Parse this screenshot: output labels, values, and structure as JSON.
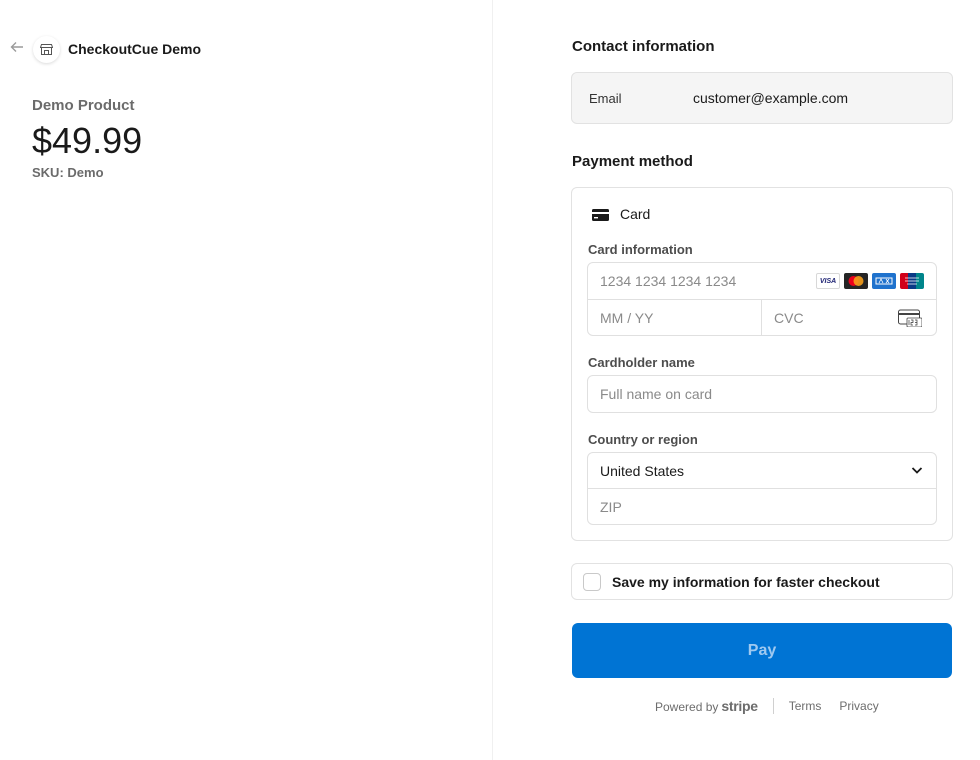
{
  "merchant": {
    "name": "CheckoutCue Demo",
    "logo_icon": "storefront-icon",
    "back_icon": "arrow-left-icon"
  },
  "product": {
    "name": "Demo Product",
    "price": "$49.99",
    "sku": "SKU: Demo"
  },
  "contact": {
    "title": "Contact information",
    "email_label": "Email",
    "email_value": "customer@example.com"
  },
  "payment": {
    "title": "Payment method",
    "method_label": "Card",
    "method_icon": "credit-card-icon",
    "card_info_label": "Card information",
    "card_number_placeholder": "1234 1234 1234 1234",
    "expiry_placeholder": "MM / YY",
    "cvc_placeholder": "CVC",
    "card_brands": [
      "VISA",
      "Mastercard",
      "AMEX",
      "UnionPay"
    ],
    "cardholder_label": "Cardholder name",
    "cardholder_placeholder": "Full name on card",
    "country_label": "Country or region",
    "country_value": "United States",
    "zip_placeholder": "ZIP"
  },
  "save_info": {
    "label": "Save my information for faster checkout",
    "checked": false
  },
  "pay_button": {
    "label": "Pay"
  },
  "footer": {
    "powered_by": "Powered by",
    "brand": "stripe",
    "terms": "Terms",
    "privacy": "Privacy"
  },
  "colors": {
    "accent": "#0074d4",
    "pay_text": "#9fc9f0",
    "muted_text": "#6b6b6b"
  }
}
